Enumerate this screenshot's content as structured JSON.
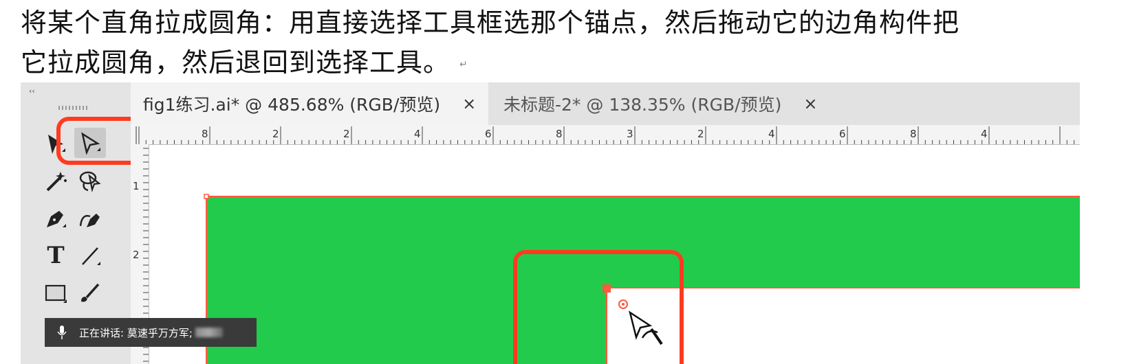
{
  "caption": {
    "line1": "将某个直角拉成圆角：用直接选择工具框选那个锚点，然后拖动它的边角构件把",
    "line2": "它拉成圆角，然后退回到选择工具。",
    "return_mark": "↵"
  },
  "toolbar": {
    "collapse_label": "‹‹",
    "tools": [
      "selection-tool",
      "direct-selection-tool",
      "magic-wand-tool",
      "lasso-tool",
      "pen-tool",
      "curvature-tool",
      "type-tool",
      "line-segment-tool",
      "rectangle-tool",
      "paintbrush-tool",
      "shaper-tool",
      "scissors-tool"
    ],
    "type_tool_glyph": "T"
  },
  "tabs": [
    {
      "label": "fig1练习.ai* @ 485.68% (RGB/预览)",
      "close": "×",
      "active": true
    },
    {
      "label": "未标题-2* @ 138.35% (RGB/预览)",
      "close": "×",
      "active": false
    }
  ],
  "ruler": {
    "horizontal_labels": [
      "8",
      "2",
      "2",
      "4",
      "6",
      "8",
      "3",
      "2",
      "4",
      "6",
      "8",
      "4"
    ],
    "vertical_labels": [
      "1",
      "2"
    ]
  },
  "canvas": {
    "shape_fill": "#22cb4c",
    "shape_stroke": "#ff5a3c",
    "highlight_color": "#ff3b1f"
  },
  "status": {
    "speaking_text": "正在讲话: 莫速乎万方军;"
  }
}
